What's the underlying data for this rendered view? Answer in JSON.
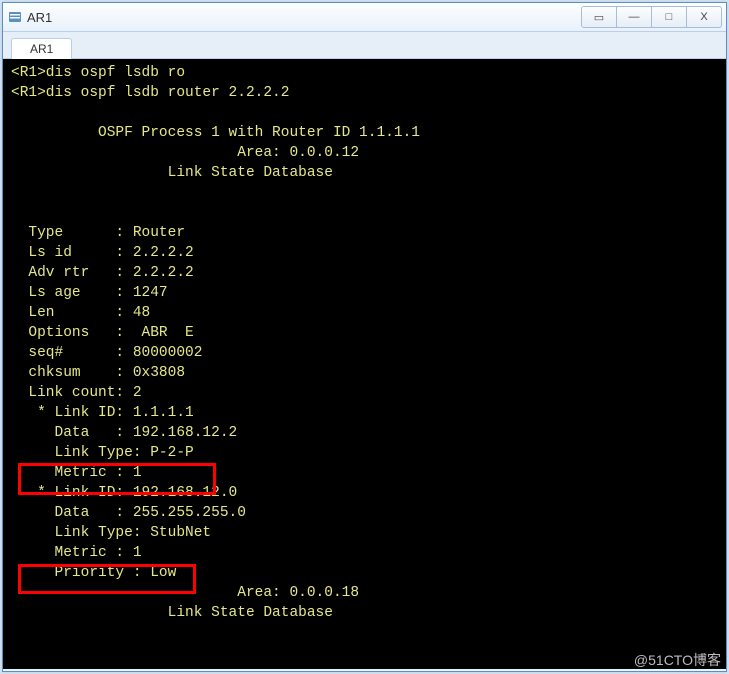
{
  "window": {
    "title": "AR1",
    "controls": {
      "info": "▭",
      "min": "—",
      "max": "□",
      "close": "X"
    }
  },
  "tabs": [
    {
      "label": "AR1"
    }
  ],
  "terminal": {
    "lines": [
      "<R1>dis ospf lsdb ro",
      "<R1>dis ospf lsdb router 2.2.2.2",
      "",
      "          OSPF Process 1 with Router ID 1.1.1.1",
      "                          Area: 0.0.0.12",
      "                  Link State Database",
      "",
      "",
      "  Type      : Router",
      "  Ls id     : 2.2.2.2",
      "  Adv rtr   : 2.2.2.2",
      "  Ls age    : 1247",
      "  Len       : 48",
      "  Options   :  ABR  E",
      "  seq#      : 80000002",
      "  chksum    : 0x3808",
      "  Link count: 2",
      "   * Link ID: 1.1.1.1",
      "     Data   : 192.168.12.2",
      "     Link Type: P-2-P",
      "     Metric : 1",
      "   * Link ID: 192.168.12.0",
      "     Data   : 255.255.255.0",
      "     Link Type: StubNet",
      "     Metric : 1",
      "     Priority : Low",
      "                          Area: 0.0.0.18",
      "                  Link State Database"
    ]
  },
  "watermark": "@51CTO博客"
}
